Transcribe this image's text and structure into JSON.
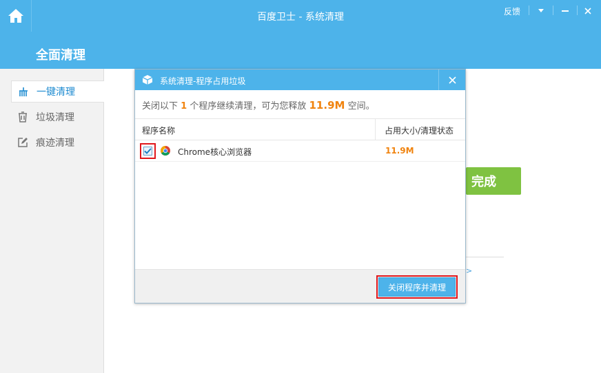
{
  "window": {
    "title": "百度卫士 - 系统清理",
    "feedback_label": "反馈"
  },
  "header": {
    "section_title": "全面清理"
  },
  "sidebar": {
    "items": [
      {
        "label": "一键清理",
        "icon": "broom-icon",
        "active": true
      },
      {
        "label": "垃圾清理",
        "icon": "trash-icon",
        "active": false
      },
      {
        "label": "痕迹清理",
        "icon": "edit-icon",
        "active": false
      }
    ]
  },
  "background": {
    "done_button": "完成",
    "link_arrow": ">"
  },
  "dialog": {
    "title": "系统清理-程序占用垃圾",
    "message": {
      "prefix": "关闭以下",
      "count": "1",
      "middle": "个程序继续清理，可为您释放",
      "size": "11.9M",
      "suffix": "空间。"
    },
    "columns": {
      "name": "程序名称",
      "size": "占用大小/清理状态"
    },
    "rows": [
      {
        "name": "Chrome核心浏览器",
        "size": "11.9M",
        "checked": true
      }
    ],
    "action_button": "关闭程序并清理"
  },
  "colors": {
    "accent": "#4db3ea",
    "highlight": "#f0830e",
    "success": "#7fc241",
    "annotation": "#e0161b"
  }
}
